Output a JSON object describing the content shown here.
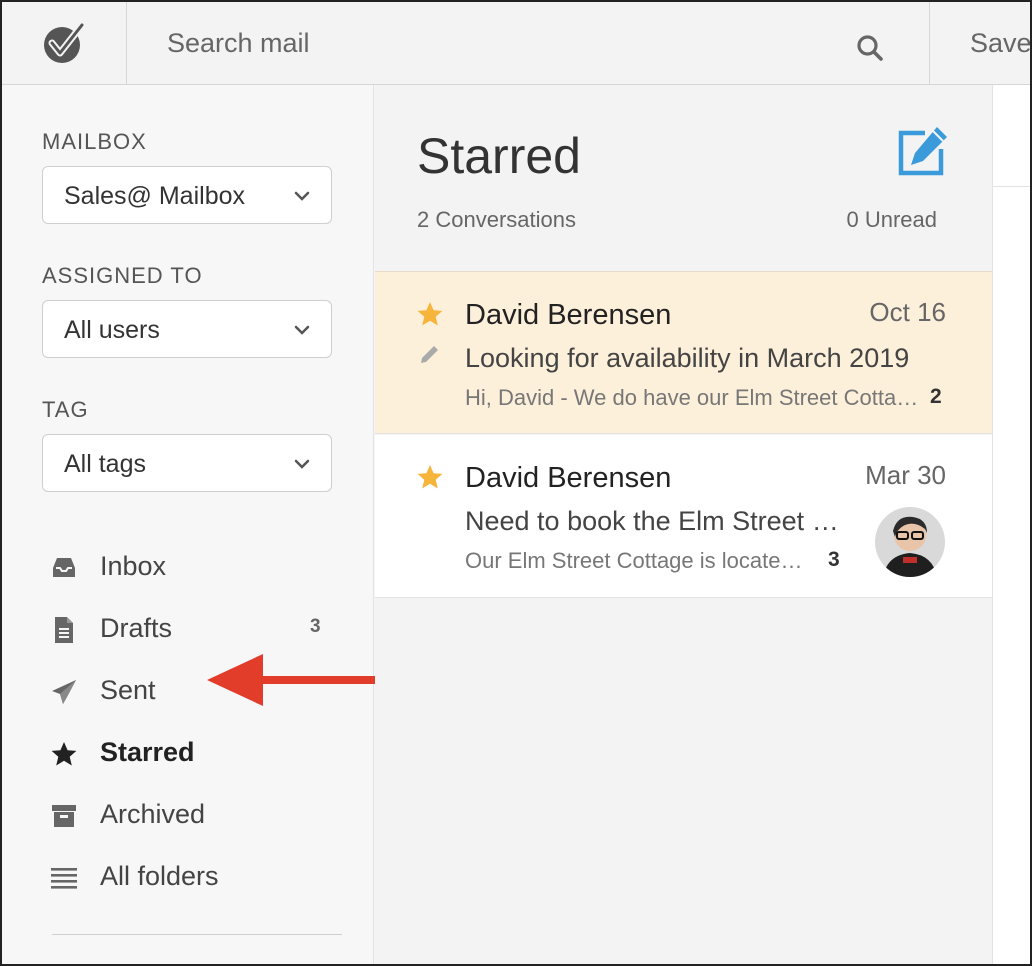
{
  "topbar": {
    "search_placeholder": "Search mail",
    "saved_label": "Saved",
    "logo_icon": "checkmark-logo-icon",
    "search_icon": "search-icon"
  },
  "sidebar": {
    "mailbox": {
      "label": "MAILBOX",
      "value": "Sales@ Mailbox"
    },
    "assigned": {
      "label": "ASSIGNED TO",
      "value": "All users"
    },
    "tag": {
      "label": "TAG",
      "value": "All tags"
    },
    "items": [
      {
        "label": "Inbox",
        "icon": "inbox-icon",
        "count": ""
      },
      {
        "label": "Drafts",
        "icon": "document-icon",
        "count": "3"
      },
      {
        "label": "Sent",
        "icon": "paper-plane-icon",
        "count": ""
      },
      {
        "label": "Starred",
        "icon": "star-icon",
        "count": "",
        "active": true
      },
      {
        "label": "Archived",
        "icon": "archive-box-icon",
        "count": ""
      },
      {
        "label": "All folders",
        "icon": "list-icon",
        "count": ""
      }
    ]
  },
  "list": {
    "title": "Starred",
    "conversations_count": "2 Conversations",
    "unread_count": "0 Unread",
    "compose_icon": "compose-icon",
    "conversations": [
      {
        "name": "David Berensen",
        "date": "Oct 16",
        "subject": "Looking for availability in March 2019",
        "preview": "Hi, David - We do have our Elm Street Cottage available in March",
        "count": "2",
        "draft": true,
        "highlighted": true
      },
      {
        "name": "David Berensen",
        "date": "Mar 30",
        "subject": "Need to book the Elm Street Cottage",
        "preview": "Our Elm Street Cottage is located downtown",
        "count": "3",
        "draft": false,
        "highlighted": false
      }
    ]
  },
  "colors": {
    "accent_blue": "#3b9ad9",
    "star_yellow": "#f6b53a",
    "highlight_bg": "#fdf0da",
    "arrow_red": "#e23c2b"
  }
}
